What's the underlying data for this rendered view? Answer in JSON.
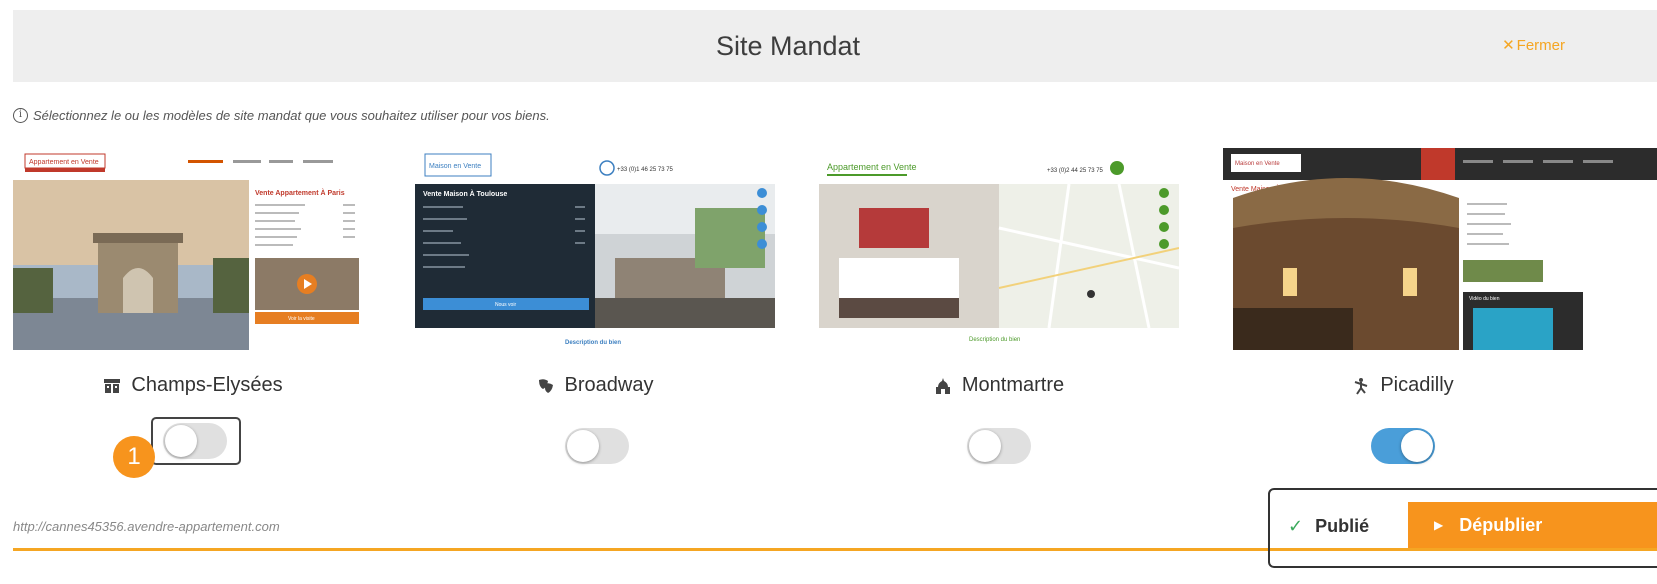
{
  "header": {
    "title": "Site Mandat",
    "close_label": "Fermer"
  },
  "info_text": "Sélectionnez le ou les modèles de site mandat que vous souhaitez utiliser pour vos biens.",
  "templates": [
    {
      "name": "Champs-Elysées",
      "icon": "theater-icon",
      "enabled": false,
      "thumb": {
        "logo": "Appartement en Vente",
        "listing_title": "Vente Appartement À Paris",
        "cta": "Voir la visite"
      }
    },
    {
      "name": "Broadway",
      "icon": "masks-icon",
      "enabled": false,
      "thumb": {
        "logo": "Maison en Vente",
        "phone": "+33 (0)1 46 25 73 75",
        "listing_title": "Vente Maison À Toulouse",
        "cta": "Nous voir",
        "description": "Description du bien"
      }
    },
    {
      "name": "Montmartre",
      "icon": "sacre-coeur-icon",
      "enabled": false,
      "thumb": {
        "logo": "Appartement en Vente",
        "phone": "+33 (0)2 44 25 73 75",
        "description": "Description du bien"
      }
    },
    {
      "name": "Picadilly",
      "icon": "dancer-icon",
      "enabled": true,
      "thumb": {
        "logo": "Maison en Vente",
        "listing_title": "Vente Maison À Rustrel",
        "video": "Vidéo du bien"
      }
    }
  ],
  "annotation_badge": "1",
  "footer": {
    "url": "http://cannes45356.avendre-appartement.com",
    "status_label": "Publié",
    "unpublish_label": "Dépublier"
  },
  "colors": {
    "accent": "#f7941d",
    "toggle_on": "#4a9ed9",
    "header_bg": "#eeeeee",
    "check": "#3aaa5c"
  }
}
